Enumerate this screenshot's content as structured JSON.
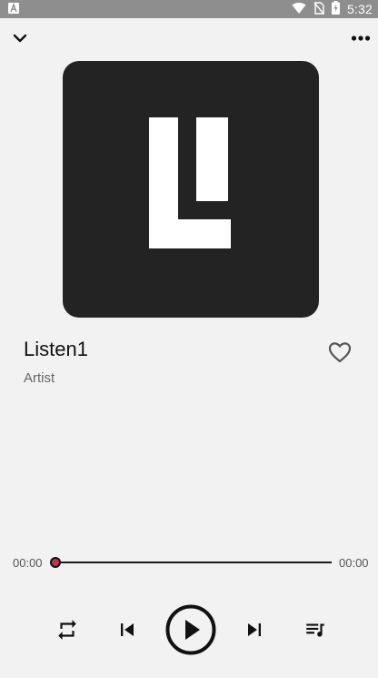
{
  "status_bar": {
    "time": "5:32",
    "icons": [
      "notification-a-icon",
      "wifi-icon",
      "no-sim-icon",
      "battery-charging-icon"
    ]
  },
  "top_bar": {
    "left_icon": "chevron-down-icon",
    "right_icon": "more-horizontal-icon"
  },
  "album_art": {
    "logo_letters": "LI",
    "background_color": "#232323",
    "logo_color": "#ffffff"
  },
  "track": {
    "title": "Listen1",
    "artist": "Artist",
    "favorite_icon": "heart-outline-icon"
  },
  "progress": {
    "current_time": "00:00",
    "total_time": "00:00",
    "fraction": 0
  },
  "controls": {
    "repeat_icon": "repeat-icon",
    "previous_icon": "skip-previous-icon",
    "play_icon": "play-circle-icon",
    "next_icon": "skip-next-icon",
    "queue_icon": "queue-music-icon"
  },
  "colors": {
    "background": "#f2f2f2",
    "status_bar": "#8e8e8e",
    "accent_thumb": "#c0324a",
    "text_primary": "#111111",
    "text_secondary": "#666666"
  }
}
